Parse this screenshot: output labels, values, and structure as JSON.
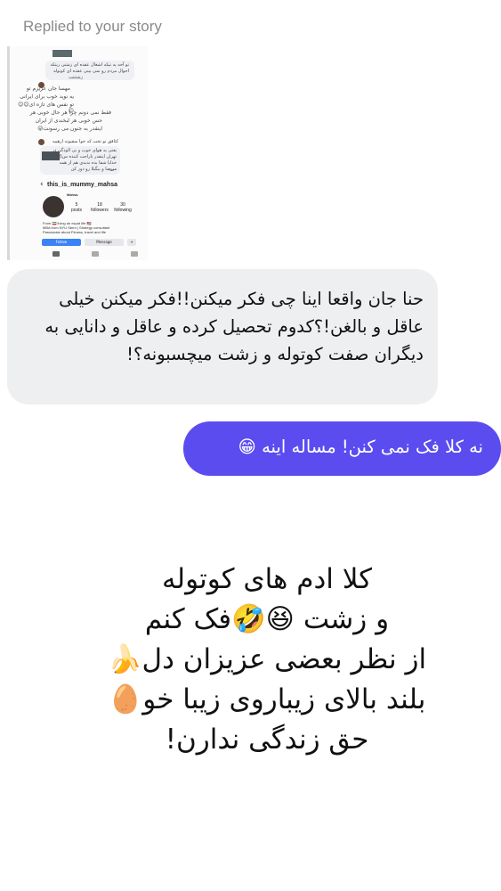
{
  "header": {
    "replied_label": "Replied to your story"
  },
  "story_thumbnail": {
    "lines": [
      "تو آخه یه تیکه اشغال عقده ای زشتی زیتکه",
      "احوال مردم رو نمی بینی عقده ای کوتوله",
      "زشتتتت",
      "مهسا جان عزیزم تو",
      "یه نوید خوب برای ایرانی",
      "تو نفس های تازه ای😊😊😊",
      "فقط نمی دونم چرا هر حال خوبی هر",
      "حس خوبی هر لبخندی از ایران",
      "اینقدر به جنون می رسونت😜",
      "کثافق تو تخت که خوا سقیونه ارهییه",
      "یعنی یه هوای خوب و بی الودگی در",
      "تهران اینقدر ناراحت کننده س😣",
      "خدایا شفا بده ندیدی هم از همه میر",
      "مریضا و بیگیلا رو دور کن"
    ],
    "profile": {
      "username": "this_is_mummy_mahsa",
      "name": "Mahsa",
      "stats": [
        {
          "value": "5",
          "label": "posts"
        },
        {
          "value": "18",
          "label": "followers"
        },
        {
          "value": "30",
          "label": "following"
        }
      ],
      "bio": [
        "From 🇮🇷 living an expat life 🇺🇸",
        "MBA from NYU Stern | Strategy consultant",
        "Passionate about Fitness, travel and life"
      ],
      "follow_label": "Follow",
      "message_label": "Message"
    }
  },
  "messages": {
    "received": "حنا جان واقعا اینا چی فکر میکنن!!فکر میکنن خیلی عاقل و بالغن!؟کدوم تحصیل کرده و عاقل و دانایی به دیگران صفت کوتوله و زشت میچسبونه؟!",
    "sent_text": "نه کلا فک نمی کنن! مساله اینه",
    "sent_emoji": "😁"
  },
  "story_text": {
    "line1": "کلا ادم های کوتوله",
    "line2_a": "و زشت ",
    "line2_emoji": "😆🤣",
    "line2_b": "فک کنم",
    "line3_a": "از نظر بعضی عزیزان دل",
    "line3_emoji": "🍌",
    "line4_a": "بلند بالای زیباروی زیبا خو",
    "line4_emoji": "🥚",
    "line5": "حق زندگی ندارن!"
  },
  "colors": {
    "sent_bubble": "#5b4cf0",
    "received_bubble": "#eeeff1",
    "header_text": "#8a8a8e"
  }
}
